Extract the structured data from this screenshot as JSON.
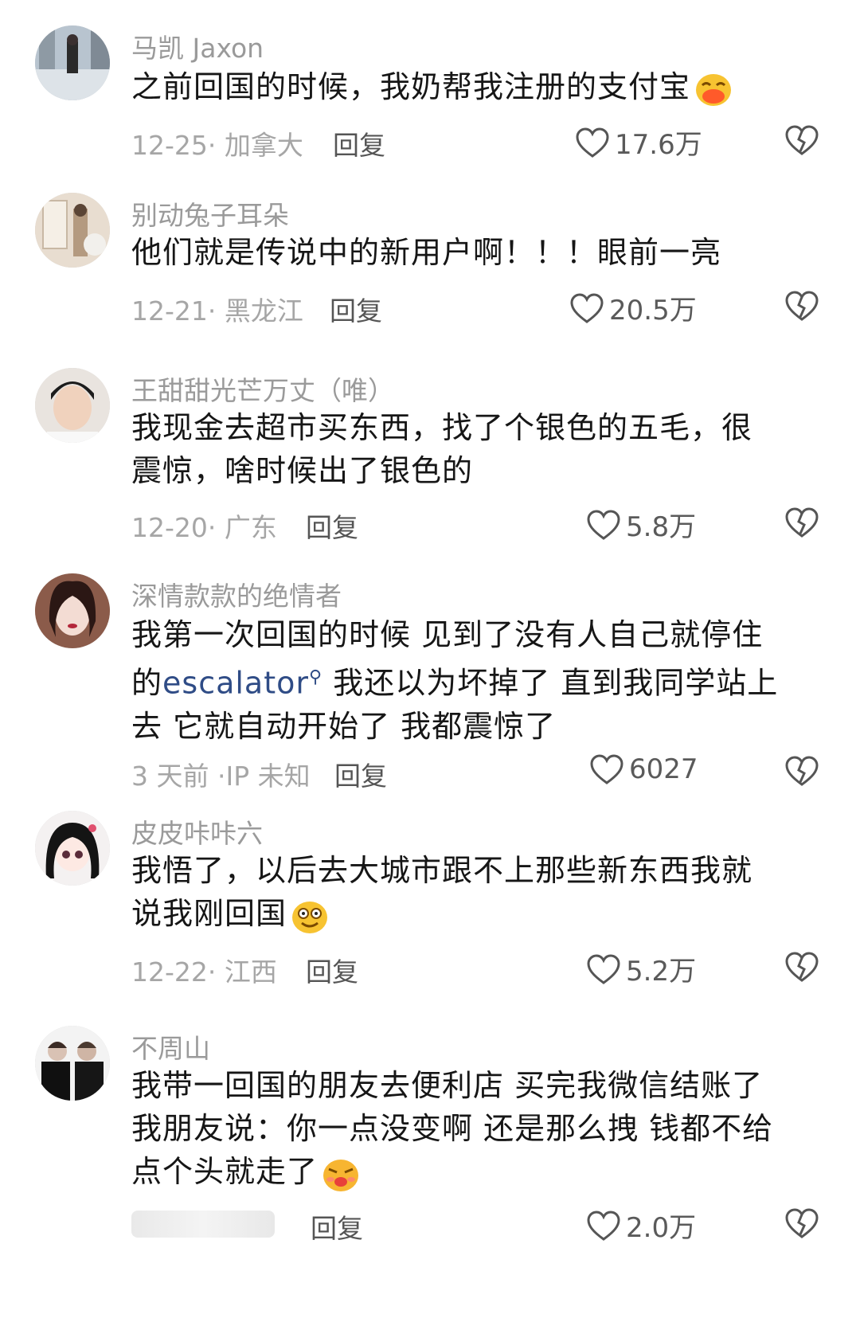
{
  "comments": [
    {
      "username": "马凯 Jaxon",
      "text": "之前回国的时候，我奶帮我注册的支付宝",
      "emoji": "laughing-face",
      "date_location": "12-25· 加拿大",
      "reply_label": "回复",
      "likes": "17.6万"
    },
    {
      "username": "别动兔子耳朵",
      "text": "他们就是传说中的新用户啊！！！眼前一亮",
      "date_location": "12-21· 黑龙江",
      "reply_label": "回复",
      "likes": "20.5万"
    },
    {
      "username": "王甜甜光芒万丈（唯）",
      "text": "我现金去超市买东西，找了个银色的五毛，很震惊，啥时候出了银色的",
      "date_location": "12-20· 广东",
      "reply_label": "回复",
      "likes": "5.8万"
    },
    {
      "username": "深情款款的绝情者",
      "text_before": "我第一次回国的时候 见到了没有人自己就停住的",
      "link": "escalator",
      "text_after": " 我还以为坏掉了 直到我同学站上去 它就自动开始了 我都震惊了",
      "date_location": "3 天前 ·IP 未知",
      "reply_label": "回复",
      "likes": "6027"
    },
    {
      "username": "皮皮咔咔六",
      "text": "我悟了，以后去大城市跟不上那些新东西我就说我刚回国",
      "emoji": "dizzy-smile-face",
      "date_location": "12-22· 江西",
      "reply_label": "回复",
      "likes": "5.2万"
    },
    {
      "username": "不周山",
      "text": "我带一回国的朋友去便利店 买完我微信结账了我朋友说：你一点没变啊 还是那么拽 钱都不给点个头就走了",
      "emoji": "pouting-face",
      "reply_label": "回复",
      "likes": "2.0万"
    }
  ],
  "icons": {
    "like": "heart-outline-icon",
    "dislike": "broken-heart-icon",
    "link_search": "search-icon"
  }
}
